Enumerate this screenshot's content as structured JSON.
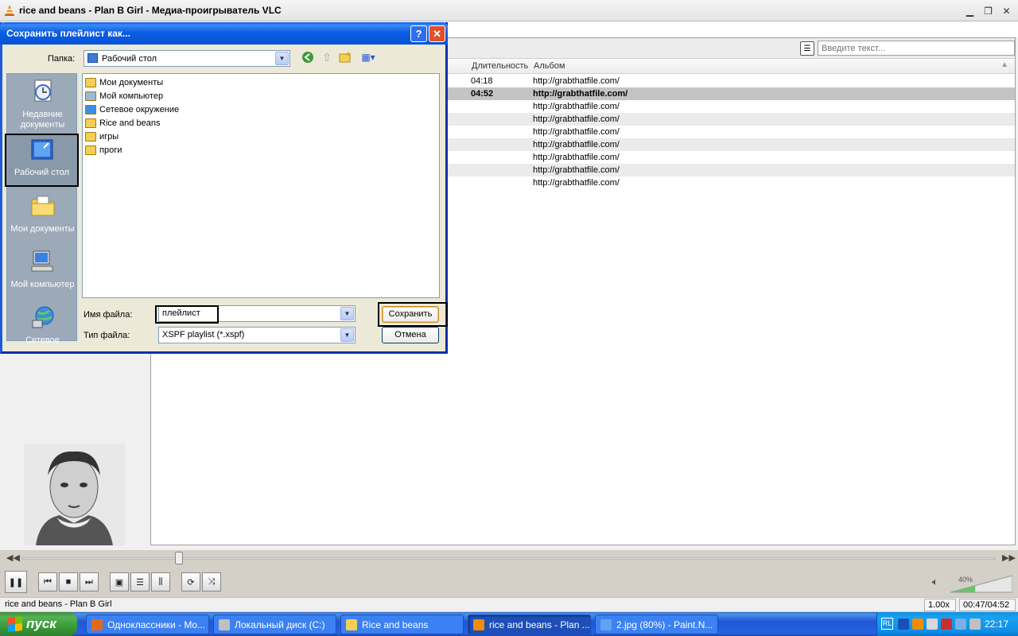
{
  "vlc": {
    "title": "rice and beans - Plan B Girl - Медиа-проигрыватель VLC",
    "search_placeholder": "Введите текст...",
    "columns": {
      "duration": "Длительность",
      "album": "Альбом"
    },
    "rows": [
      {
        "duration": "04:18",
        "album": "http://grabthatfile.com/"
      },
      {
        "duration": "04:52",
        "album": "http://grabthatfile.com/"
      },
      {
        "duration": "",
        "album": "http://grabthatfile.com/"
      },
      {
        "duration": "",
        "album": "http://grabthatfile.com/"
      },
      {
        "duration": "",
        "album": "http://grabthatfile.com/"
      },
      {
        "duration": "",
        "album": "http://grabthatfile.com/"
      },
      {
        "duration": "",
        "album": "http://grabthatfile.com/"
      },
      {
        "duration": "",
        "album": "http://grabthatfile.com/"
      },
      {
        "duration": "",
        "album": "http://grabthatfile.com/"
      }
    ],
    "current_row": 1,
    "seek_position": 0.162,
    "volume_label": "40%",
    "volume": 0.4,
    "status_text": "rice and beans - Plan B Girl",
    "speed": "1.00x",
    "time": "00:47/04:52"
  },
  "dialog": {
    "title": "Сохранить плейлист как...",
    "help_label": "?",
    "close_label": "✕",
    "folder_label": "Папка:",
    "folder_value": "Рабочий стол",
    "places": [
      {
        "label": "Недавние документы",
        "icon": "recent-documents-icon"
      },
      {
        "label": "Рабочий стол",
        "icon": "desktop-icon"
      },
      {
        "label": "Мои документы",
        "icon": "my-documents-icon"
      },
      {
        "label": "Мой компьютер",
        "icon": "my-computer-icon"
      },
      {
        "label": "Сетевое",
        "icon": "network-icon"
      }
    ],
    "files": [
      {
        "name": "Мои документы",
        "icon": "my-documents-icon"
      },
      {
        "name": "Мой компьютер",
        "icon": "my-computer-icon"
      },
      {
        "name": "Сетевое окружение",
        "icon": "network-icon"
      },
      {
        "name": "Rice and beans",
        "icon": "folder-icon"
      },
      {
        "name": "игры",
        "icon": "folder-icon"
      },
      {
        "name": "проги",
        "icon": "folder-icon"
      }
    ],
    "filename_label": "Имя файла:",
    "filename_value": "плейлист",
    "filetype_label": "Тип файла:",
    "filetype_value": "XSPF playlist (*.xspf)",
    "save_label": "Сохранить",
    "cancel_label": "Отмена"
  },
  "taskbar": {
    "start_label": "пуск",
    "tasks": [
      {
        "label": "Одноклассники - Mo...",
        "icon": "firefox-icon"
      },
      {
        "label": "Локальный диск (C:)",
        "icon": "drive-icon"
      },
      {
        "label": "Rice and beans",
        "icon": "folder-icon"
      },
      {
        "label": "rice and beans - Plan ...",
        "icon": "vlc-icon"
      },
      {
        "label": "2.jpg (80%) - Paint.N...",
        "icon": "paint-icon"
      }
    ],
    "active_task": 3,
    "lang": "RL",
    "clock": "22:17"
  },
  "colors": {
    "xp_blue": "#2157d7",
    "start_green": "#3a9c3a",
    "dialog_border": "#0831a8",
    "vlc_cone": "#f08c00"
  }
}
